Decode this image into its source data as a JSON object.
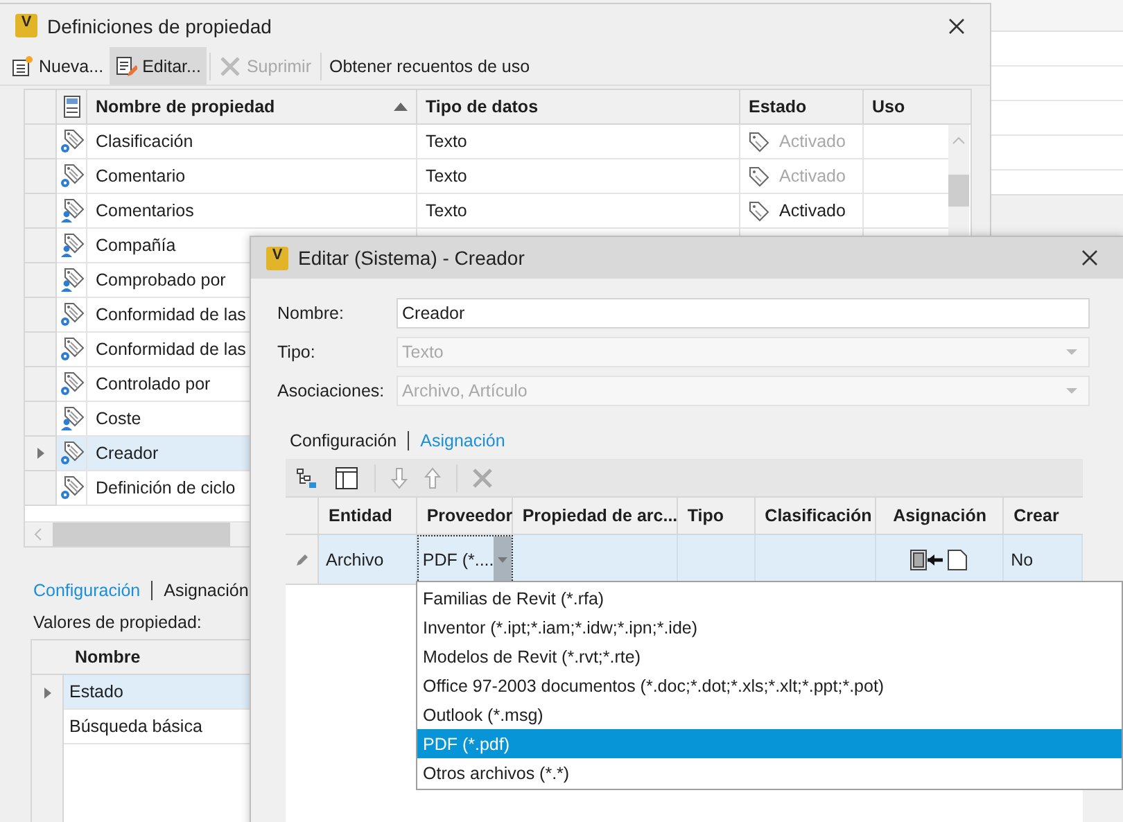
{
  "main_window": {
    "title": "Definiciones de propiedad",
    "logo_letter": "V",
    "toolbar": [
      {
        "kind": "new",
        "label": "Nueva...",
        "pressed": false,
        "disabled": false
      },
      {
        "kind": "edit",
        "label": "Editar...",
        "pressed": true,
        "disabled": false
      },
      {
        "kind": "delete",
        "label": "Suprimir",
        "pressed": false,
        "disabled": true
      },
      {
        "kind": "text",
        "label": "Obtener recuentos de uso",
        "pressed": false,
        "disabled": false
      }
    ],
    "table": {
      "columns": [
        {
          "label": "Nombre de propiedad",
          "sorted": true
        },
        {
          "label": "Tipo de datos",
          "sorted": false
        },
        {
          "label": "Estado",
          "sorted": false
        },
        {
          "label": "Uso",
          "sorted": false
        }
      ],
      "rows": [
        {
          "name": "Clasificación",
          "kind": "system",
          "tipo": "Texto",
          "estado": "Activado",
          "estado_greyed": true,
          "selected": false
        },
        {
          "name": "Comentario",
          "kind": "system",
          "tipo": "Texto",
          "estado": "Activado",
          "estado_greyed": true,
          "selected": false
        },
        {
          "name": "Comentarios",
          "kind": "user",
          "tipo": "Texto",
          "estado": "Activado",
          "estado_greyed": false,
          "selected": false
        },
        {
          "name": "Compañía",
          "kind": "user",
          "selected": false
        },
        {
          "name": "Comprobado por",
          "kind": "user",
          "selected": false
        },
        {
          "name": "Conformidad de las",
          "kind": "system",
          "selected": false
        },
        {
          "name": "Conformidad de las",
          "kind": "system",
          "selected": false
        },
        {
          "name": "Controlado por",
          "kind": "system",
          "selected": false
        },
        {
          "name": "Coste",
          "kind": "user",
          "selected": false
        },
        {
          "name": "Creador",
          "kind": "system",
          "selected": true
        },
        {
          "name": "Definición de ciclo",
          "kind": "system",
          "selected": false
        }
      ]
    },
    "tabs": [
      {
        "label": "Configuración",
        "selected": true
      },
      {
        "label": "Asignación",
        "selected": false
      }
    ],
    "values_label": "Valores de propiedad:",
    "values_table": {
      "columns": [
        "Nombre"
      ],
      "rows": [
        {
          "name": "Estado",
          "selected": true
        },
        {
          "name": "Búsqueda básica",
          "selected": false
        }
      ]
    }
  },
  "dialog": {
    "title": "Editar (Sistema) - Creador",
    "logo_letter": "V",
    "fields": [
      {
        "label": "Nombre:",
        "value": "Creador",
        "kind": "text",
        "disabled": false
      },
      {
        "label": "Tipo:",
        "value": "Texto",
        "kind": "combo",
        "disabled": true
      },
      {
        "label": "Asociaciones:",
        "value": "Archivo, Artículo",
        "kind": "combo",
        "disabled": true
      }
    ],
    "tabs": [
      {
        "label": "Configuración",
        "selected": false
      },
      {
        "label": "Asignación",
        "selected": true
      }
    ],
    "toolbar": [
      {
        "kind": "tree",
        "disabled": false
      },
      {
        "kind": "panel",
        "disabled": false
      },
      {
        "kind": "down",
        "disabled": true
      },
      {
        "kind": "up",
        "disabled": true
      },
      {
        "kind": "delete",
        "disabled": true
      }
    ],
    "table": {
      "columns": [
        "Entidad",
        "Proveedor",
        "Propiedad de arc...",
        "Tipo",
        "Clasificación",
        "Asignación",
        "Crear"
      ],
      "rows": [
        {
          "entidad": "Archivo",
          "proveedor": "PDF (*....",
          "crear": "No",
          "editing": true
        }
      ]
    },
    "dropdown": {
      "items": [
        {
          "label": "Familias de Revit (*.rfa)",
          "selected": false
        },
        {
          "label": "Inventor (*.ipt;*.iam;*.idw;*.ipn;*.ide)",
          "selected": false
        },
        {
          "label": "Modelos de Revit (*.rvt;*.rte)",
          "selected": false
        },
        {
          "label": "Office 97-2003 documentos (*.doc;*.dot;*.xls;*.xlt;*.ppt;*.pot)",
          "selected": false
        },
        {
          "label": "Outlook (*.msg)",
          "selected": false
        },
        {
          "label": "PDF (*.pdf)",
          "selected": true
        },
        {
          "label": "Otros archivos (*.*)",
          "selected": false
        }
      ]
    }
  }
}
